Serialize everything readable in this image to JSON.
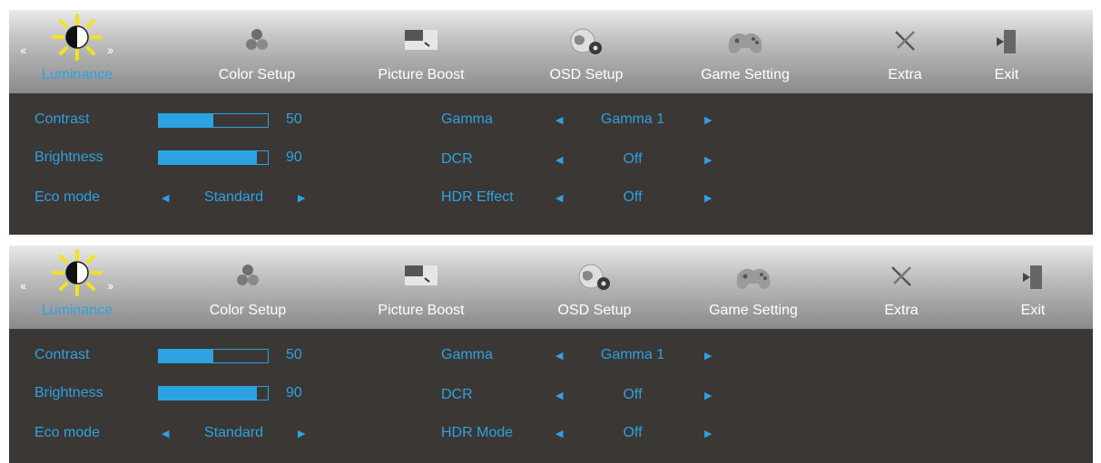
{
  "panels": [
    {
      "tabs": [
        {
          "label": "Luminance",
          "icon": "sun-icon",
          "active": true
        },
        {
          "label": "Color Setup",
          "icon": "color-balls-icon"
        },
        {
          "label": "Picture Boost",
          "icon": "picture-boost-icon"
        },
        {
          "label": "OSD Setup",
          "icon": "osd-globe-gear-icon"
        },
        {
          "label": "Game Setting",
          "icon": "gamepad-icon"
        },
        {
          "label": "Extra",
          "icon": "tools-icon"
        },
        {
          "label": "Exit",
          "icon": "exit-door-icon"
        }
      ],
      "left": [
        {
          "label": "Contrast",
          "type": "bar",
          "value": 50,
          "max": 100
        },
        {
          "label": "Brightness",
          "type": "bar",
          "value": 90,
          "max": 100
        },
        {
          "label": "Eco mode",
          "type": "select",
          "value": "Standard"
        }
      ],
      "right": [
        {
          "label": "Gamma",
          "value": "Gamma 1"
        },
        {
          "label": "DCR",
          "value": "Off"
        },
        {
          "label": "HDR Effect",
          "value": "Off"
        }
      ]
    },
    {
      "tabs": [
        {
          "label": "Luminance",
          "icon": "sun-icon",
          "active": true
        },
        {
          "label": "Color Setup",
          "icon": "color-balls-icon"
        },
        {
          "label": "Picture Boost",
          "icon": "picture-boost-icon"
        },
        {
          "label": "OSD Setup",
          "icon": "osd-globe-gear-icon"
        },
        {
          "label": "Game Setting",
          "icon": "gamepad-icon"
        },
        {
          "label": "Extra",
          "icon": "tools-icon"
        },
        {
          "label": "Exit",
          "icon": "exit-door-icon"
        }
      ],
      "left": [
        {
          "label": "Contrast",
          "type": "bar",
          "value": 50,
          "max": 100
        },
        {
          "label": "Brightness",
          "type": "bar",
          "value": 90,
          "max": 100
        },
        {
          "label": "Eco mode",
          "type": "select",
          "value": "Standard"
        }
      ],
      "right": [
        {
          "label": "Gamma",
          "value": "Gamma 1"
        },
        {
          "label": "DCR",
          "value": "Off"
        },
        {
          "label": "HDR Mode",
          "value": "Off"
        }
      ]
    }
  ],
  "colors": {
    "accent": "#2da2e0",
    "panel_bg": "#3b3735",
    "sun": "#f2e21e"
  }
}
